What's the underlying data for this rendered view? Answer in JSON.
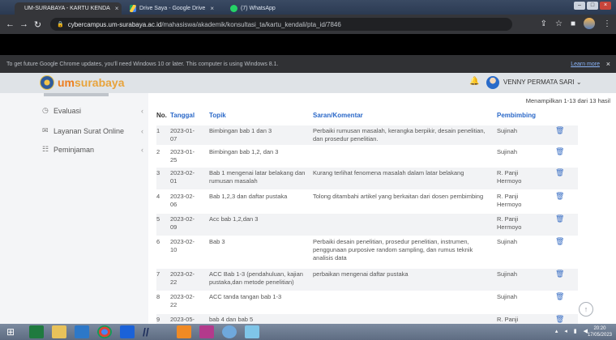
{
  "browser": {
    "tabs": [
      {
        "label": "UM-SURABAYA - KARTU KENDA",
        "close": "×"
      },
      {
        "label": "Drive Saya - Google Drive",
        "close": "×"
      },
      {
        "label": "(7) WhatsApp",
        "close": ""
      }
    ],
    "address": {
      "host": "cybercampus.um-surabaya.ac.id",
      "path": "/mahasiswa/akademik/konsultasi_ta/kartu_kendali/pta_id/7846"
    },
    "infobar": {
      "message": "To get future Google Chrome updates, you'll need Windows 10 or later. This computer is using Windows 8.1.",
      "learn_more": "Learn more",
      "close": "×"
    }
  },
  "app": {
    "logo_prefix": "um",
    "logo_text": "surabaya",
    "user_name": "VENNY PERMATA SARI",
    "user_chevron": "⌄"
  },
  "sidebar": {
    "items": [
      {
        "label": "Evaluasi",
        "icon": "clock-icon",
        "glyph": "◷"
      },
      {
        "label": "Layanan Surat Online",
        "icon": "mail-icon",
        "glyph": "✉"
      },
      {
        "label": "Peminjaman",
        "icon": "list-icon",
        "glyph": "☷"
      }
    ],
    "chevron": "‹"
  },
  "table": {
    "summary": "Menampilkan 1-13 dari 13 hasil",
    "headers": {
      "no": "No.",
      "tanggal": "Tanggal",
      "topik": "Topik",
      "saran": "Saran/Komentar",
      "pembimbing": "Pembimbing"
    },
    "rows": [
      {
        "no": "1",
        "tanggal": "2023-01-\n07",
        "topik": "Bimbingan bab 1 dan 3",
        "saran": "Perbaiki rumusan masalah, kerangka berpikir, desain penelitian,\ndan prosedur penelitian.",
        "pembimbing": "Sujinah"
      },
      {
        "no": "2",
        "tanggal": "2023-01-\n25",
        "topik": "Bimbingan bab 1,2, dan 3",
        "saran": "",
        "pembimbing": "Sujinah"
      },
      {
        "no": "3",
        "tanggal": "2023-02-\n01",
        "topik": "Bab 1 mengenai latar belakang dan\nrumusan masalah",
        "saran": "Kurang terlihat fenomena masalah dalam latar belakang",
        "pembimbing": "R. Panji\nHermoyo"
      },
      {
        "no": "4",
        "tanggal": "2023-02-\n06",
        "topik": "Bab 1,2,3 dan daftar pustaka",
        "saran": "Tolong ditambahi artikel yang berkaitan dari dosen pembimbing",
        "pembimbing": "R. Panji\nHermoyo"
      },
      {
        "no": "5",
        "tanggal": "2023-02-\n09",
        "topik": "Acc bab 1,2,dan 3",
        "saran": "",
        "pembimbing": "R. Panji\nHermoyo"
      },
      {
        "no": "6",
        "tanggal": "2023-02-\n10",
        "topik": "Bab 3",
        "saran": "Perbaiki desain penelitian, prosedur penelitian, instrumen,\npenggunaan purposive random sampling, dan rumus teknik\nanalisis data",
        "pembimbing": "Sujinah"
      },
      {
        "no": "7",
        "tanggal": "2023-02-\n22",
        "topik": "ACC Bab 1-3 (pendahuluan, kajian\npustaka,dan metode penelitian)",
        "saran": "perbaikan mengenai daftar pustaka",
        "pembimbing": "Sujinah"
      },
      {
        "no": "8",
        "tanggal": "2023-02-\n22",
        "topik": "ACC tanda tangan bab 1-3",
        "saran": "",
        "pembimbing": "Sujinah"
      },
      {
        "no": "9",
        "tanggal": "2023-05-",
        "topik": "bab 4 dan bab 5",
        "saran": "",
        "pembimbing": "R. Panji"
      }
    ]
  },
  "taskbar": {
    "time": "20:20",
    "date": "17/05/2023"
  },
  "colors": {
    "accent": "#2a68c8",
    "brand": "#ed7d1e"
  }
}
